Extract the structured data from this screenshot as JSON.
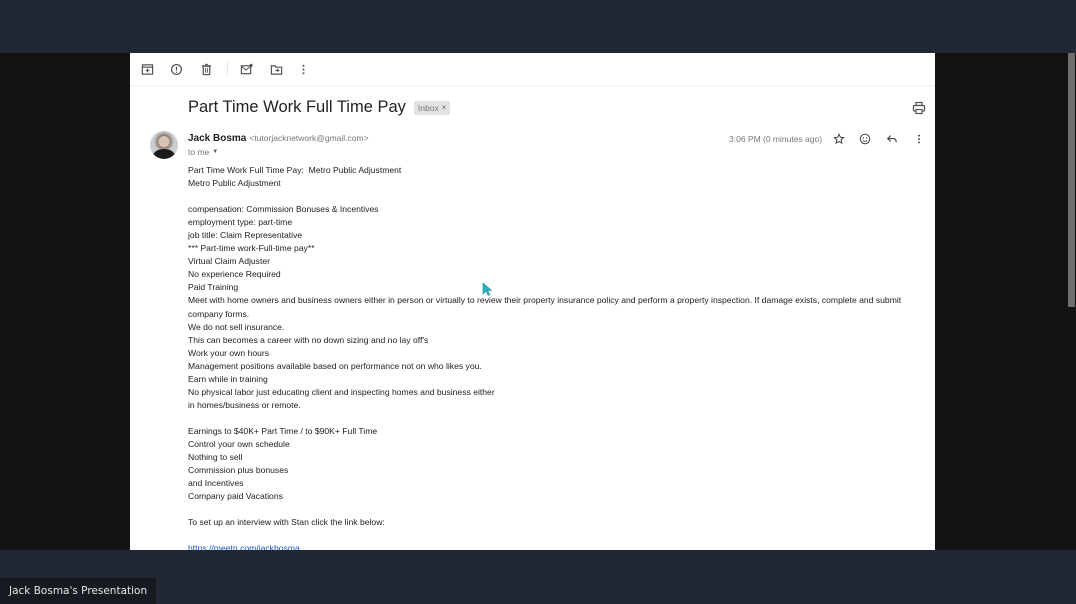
{
  "presentation": {
    "presenter_label": "Jack Bosma's Presentation"
  },
  "toolbar": {
    "icons": [
      "archive-icon",
      "report-spam-icon",
      "delete-icon",
      "mark-unread-icon",
      "move-to-icon",
      "more-icon"
    ]
  },
  "email": {
    "subject": "Part Time Work Full Time Pay",
    "label": "Inbox",
    "label_remove": "×",
    "sender_name": "Jack Bosma",
    "sender_email": "<tutorjacknetwork@gmail.com>",
    "recipient": "to me",
    "timestamp": "3:06 PM (0 minutes ago)",
    "body_lines": [
      "Part Time Work Full Time Pay:  Metro Public Adjustment",
      "Metro Public Adjustment",
      "",
      "compensation: Commission Bonuses & Incentives",
      "employment type: part-time",
      "job title: Claim Representative",
      "*** Part-time work-Full-time pay**",
      "Virtual Claim Adjuster",
      "No experience Required",
      "Paid Training",
      "Meet with home owners and business owners either in person or virtually to review their property insurance policy and perform a property inspection. If damage exists, complete and submit",
      "company forms.",
      "We do not sell insurance.",
      "This can becomes a career with no down sizing and no lay off's",
      "Work your own hours",
      "Management positions available based on performance not on who likes you.",
      "Earn while in training",
      "No physical labor just educating client and inspecting homes and business either",
      "in homes/business or remote.",
      "",
      "Earnings to $40K+ Part Time / to $90K+ Full Time",
      "Control your own schedule",
      "Nothing to sell",
      "Commission plus bonuses",
      "and Incentives",
      "Company paid Vacations",
      "",
      "To set up an interview with Stan click the link below:",
      ""
    ],
    "link": "https://meetn.com/jackbosma"
  },
  "colors": {
    "frame_bg": "#212833",
    "share_bg": "#121212",
    "link": "#1a55c4",
    "cursor": "#2bb5c4"
  }
}
